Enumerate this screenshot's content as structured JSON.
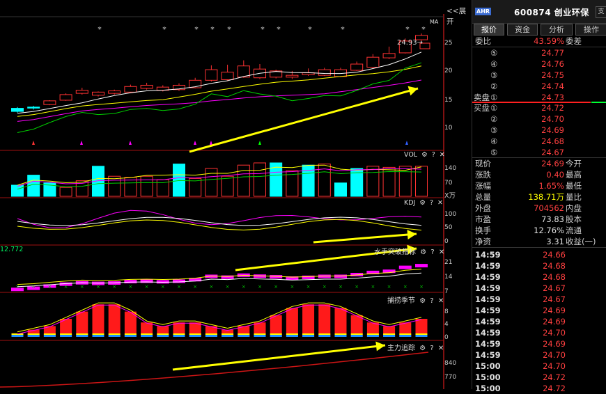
{
  "toolbar": {
    "expand_label": "<<展开"
  },
  "main_panel": {
    "ma_label": "MA",
    "last_price_label": "24.93→",
    "y_ticks": [
      "25",
      "20",
      "15",
      "10"
    ],
    "markers": "* * * * * * * * * * *"
  },
  "vol_panel": {
    "label": "VOL",
    "y_ticks": [
      "140",
      "70"
    ],
    "unit": "X万"
  },
  "kdj_panel": {
    "label": "KDJ",
    "y_ticks": [
      "100",
      "50",
      "0"
    ]
  },
  "p3_panel": {
    "label": "水手突破指标",
    "left_value": "12.772",
    "y_ticks": [
      "21",
      "14",
      "7"
    ]
  },
  "p4_panel": {
    "label": "捕捞季节",
    "y_ticks": [
      "8",
      "4",
      "0"
    ]
  },
  "p5_panel": {
    "label": "主力追踪",
    "y_ticks": [
      "840",
      "770"
    ]
  },
  "icons": {
    "gear": "⚙",
    "help": "?",
    "close": "✕"
  },
  "quote": {
    "tag": "AHR",
    "code_name": "600874 创业环保",
    "tabs": [
      "报价",
      "资金",
      "分析",
      "操作"
    ],
    "weibi_label": "委比",
    "weibi_value": "43.59%",
    "weicha_label": "委差",
    "sell_label": "卖盘",
    "buy_label": "买盘",
    "asks": [
      {
        "idx": "⑤",
        "price": "24.77"
      },
      {
        "idx": "④",
        "price": "24.76"
      },
      {
        "idx": "③",
        "price": "24.75"
      },
      {
        "idx": "②",
        "price": "24.74"
      },
      {
        "idx": "①",
        "price": "24.73"
      }
    ],
    "bids": [
      {
        "idx": "①",
        "price": "24.72"
      },
      {
        "idx": "②",
        "price": "24.70"
      },
      {
        "idx": "③",
        "price": "24.69"
      },
      {
        "idx": "④",
        "price": "24.68"
      },
      {
        "idx": "⑤",
        "price": "24.67"
      }
    ],
    "stats": [
      {
        "l1": "现价",
        "v1": "24.69",
        "r1": "今开",
        "c": "red"
      },
      {
        "l1": "涨跌",
        "v1": "0.40",
        "r1": "最高",
        "c": "red"
      },
      {
        "l1": "涨幅",
        "v1": "1.65%",
        "r1": "最低",
        "c": "red"
      },
      {
        "l1": "总量",
        "v1": "138.71万",
        "r1": "量比",
        "c": "yellow"
      },
      {
        "l1": "外盘",
        "v1": "704562",
        "r1": "内盘",
        "c": "red"
      },
      {
        "l1": "市盈",
        "v1": "73.83",
        "r1": "股本",
        "c": "white"
      },
      {
        "l1": "换手",
        "v1": "12.76%",
        "r1": "流通",
        "c": "white"
      },
      {
        "l1": "净资",
        "v1": "3.31",
        "r1": "收益(一)",
        "c": "white"
      }
    ],
    "ticks": [
      {
        "t": "14:59",
        "p": "24.66"
      },
      {
        "t": "14:59",
        "p": "24.68"
      },
      {
        "t": "14:59",
        "p": "24.68"
      },
      {
        "t": "14:59",
        "p": "24.67"
      },
      {
        "t": "14:59",
        "p": "24.67"
      },
      {
        "t": "14:59",
        "p": "24.69"
      },
      {
        "t": "14:59",
        "p": "24.69"
      },
      {
        "t": "14:59",
        "p": "24.70"
      },
      {
        "t": "14:59",
        "p": "24.69"
      },
      {
        "t": "14:59",
        "p": "24.70"
      },
      {
        "t": "15:00",
        "p": "24.70"
      },
      {
        "t": "15:00",
        "p": "24.72"
      },
      {
        "t": "15:00",
        "p": "24.72"
      }
    ]
  },
  "colors": {
    "up": "#ff3232",
    "down": "#00ffff",
    "bg": "#000000"
  },
  "chart_data": {
    "type": "candlestick",
    "price": {
      "open": [
        13.3,
        13.5,
        13.9,
        14.6,
        15.7,
        15.4,
        15.7,
        15.9,
        16.5,
        16.2,
        16.3,
        16.6,
        17.8,
        17.9,
        18.3,
        18.2,
        18.3,
        18.3,
        18.7,
        18.6,
        18.4,
        19.4,
        19.9,
        21.4,
        22.2,
        24.3
      ],
      "close": [
        12.8,
        13.4,
        14.5,
        15.5,
        16.2,
        15.9,
        16.1,
        16.8,
        17.0,
        16.7,
        17.0,
        17.8,
        19.5,
        19.1,
        20.1,
        19.6,
        19.3,
        18.6,
        19.0,
        19.5,
        19.5,
        20.4,
        21.5,
        22.1,
        24.1,
        25.0
      ],
      "high": [
        13.5,
        13.7,
        14.6,
        15.7,
        16.6,
        16.0,
        16.3,
        17.1,
        17.4,
        17.0,
        17.3,
        18.2,
        20.2,
        20.3,
        21.0,
        20.4,
        19.5,
        19.3,
        19.7,
        19.8,
        19.8,
        20.8,
        22.0,
        23.2,
        24.5,
        25.3
      ],
      "low": [
        12.6,
        13.1,
        13.8,
        14.5,
        15.5,
        15.2,
        15.5,
        15.8,
        16.3,
        16.0,
        16.1,
        16.5,
        17.6,
        17.7,
        18.2,
        18.0,
        18.1,
        18.0,
        18.5,
        18.5,
        18.3,
        19.3,
        19.8,
        21.2,
        22.1,
        24.1
      ],
      "ylim": [
        7,
        28
      ]
    },
    "volume": {
      "values": [
        50,
        95,
        60,
        40,
        70,
        135,
        90,
        85,
        90,
        75,
        145,
        80,
        125,
        90,
        140,
        150,
        150,
        115,
        140,
        145,
        60,
        125,
        135,
        130,
        135,
        135
      ],
      "up": [
        false,
        false,
        false,
        true,
        true,
        false,
        true,
        true,
        true,
        true,
        false,
        true,
        true,
        true,
        true,
        true,
        false,
        true,
        false,
        true,
        false,
        false,
        true,
        true,
        true,
        true
      ],
      "ylim": [
        0,
        175
      ]
    },
    "p4": {
      "values": [
        1,
        2,
        3,
        5,
        7,
        9,
        9,
        7,
        4,
        3,
        4,
        4,
        3,
        2,
        3,
        4,
        6,
        8,
        9,
        9,
        8,
        6,
        4,
        3,
        4,
        5
      ],
      "ylim": [
        0,
        10
      ]
    }
  }
}
